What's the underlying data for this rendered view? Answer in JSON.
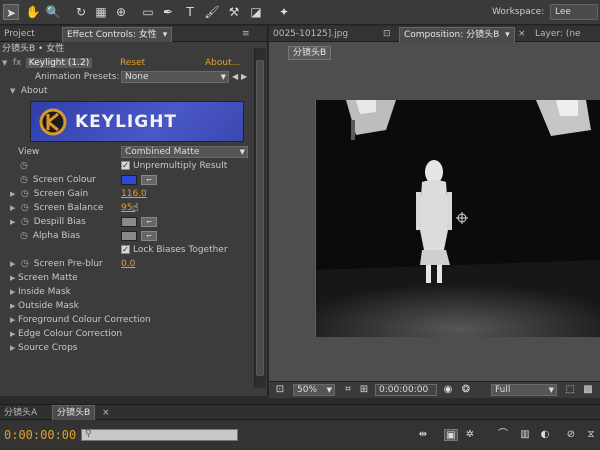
{
  "toolbar": {
    "workspace_label": "Workspace:",
    "workspace_value": "Lee"
  },
  "left_tabs": {
    "project": "Project",
    "effect_controls": "Effect Controls: 女性"
  },
  "breadcrumb": "分镜头B • 女性",
  "effect": {
    "name": "Keylight (1.2)",
    "reset": "Reset",
    "about_link": "About...",
    "animation_presets_label": "Animation Presets:",
    "animation_presets_value": "None",
    "about_section": "About",
    "banner_title": "KEYLIGHT",
    "view_label": "View",
    "view_value": "Combined Matte",
    "unpremultiply_label": "Unpremultiply Result",
    "screen_colour_label": "Screen Colour",
    "screen_colour": "#2f47d8",
    "screen_gain_label": "Screen Gain",
    "screen_gain_value": "116.0",
    "screen_balance_label": "Screen Balance",
    "screen_balance_value": "95.",
    "despill_bias_label": "Despill Bias",
    "alpha_bias_label": "Alpha Bias",
    "lock_biases_label": "Lock Biases Together",
    "screen_preblur_label": "Screen Pre-blur",
    "screen_preblur_value": "0.0",
    "sections": [
      "Screen Matte",
      "Inside Mask",
      "Outside Mask",
      "Foreground Colour Correction",
      "Edge Colour Correction",
      "Source Crops"
    ]
  },
  "right_tabs": {
    "footage": "0025-10125].jpg",
    "composition": "Composition: 分镜头B",
    "layer": "Layer: (ne"
  },
  "comp_subtab": "分镜头B",
  "viewer_toolbar": {
    "zoom": "50%",
    "timecode": "0:00:00:00",
    "resolution": "Full"
  },
  "timeline": {
    "tabs": [
      "分镜头A",
      "分镜头B"
    ],
    "timecode": "0:00:00:00"
  },
  "colors": {
    "accent_orange": "#e0a030",
    "banner_blue": "#3a48b8"
  }
}
